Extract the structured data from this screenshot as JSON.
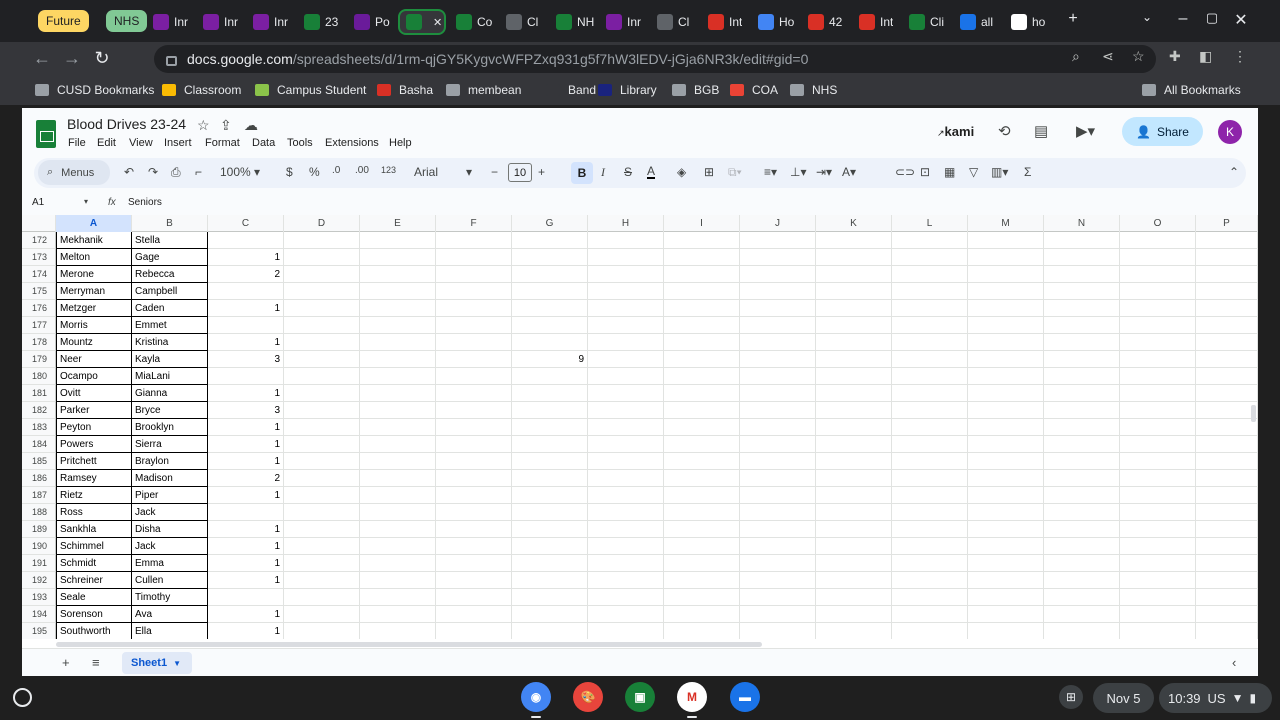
{
  "browser": {
    "group_labels": [
      {
        "label": "Future",
        "bg": "#fdd663",
        "fg": "#202124"
      },
      {
        "label": "NHS",
        "bg": "#81c995",
        "fg": "#202124"
      }
    ],
    "tabs": [
      {
        "title": "Inr",
        "icon": "membean-icon",
        "color": "#7b1fa2"
      },
      {
        "title": "Inr",
        "icon": "membean-icon",
        "color": "#7b1fa2"
      },
      {
        "title": "Inr",
        "icon": "membean-icon",
        "color": "#7b1fa2"
      },
      {
        "title": "23",
        "icon": "sheets-icon",
        "color": "#188038"
      },
      {
        "title": "Po",
        "icon": "vocab-icon",
        "color": "#6a1b9a"
      },
      {
        "title": "",
        "icon": "sheets-icon",
        "color": "#188038",
        "active": true
      },
      {
        "title": "Co",
        "icon": "sheets-icon",
        "color": "#188038"
      },
      {
        "title": "Cl",
        "icon": "classroom-icon",
        "color": "#5f6368"
      },
      {
        "title": "NH",
        "icon": "sheets-icon",
        "color": "#188038"
      },
      {
        "title": "Inr",
        "icon": "membean-icon",
        "color": "#7b1fa2"
      },
      {
        "title": "Cl",
        "icon": "classroom-icon",
        "color": "#5f6368"
      },
      {
        "title": "Int",
        "icon": "gmail-icon",
        "color": "#d93025"
      },
      {
        "title": "Ho",
        "icon": "media-icon",
        "color": "#4285f4"
      },
      {
        "title": "42",
        "icon": "basha-icon",
        "color": "#d93025"
      },
      {
        "title": "Int",
        "icon": "gmail-icon",
        "color": "#d93025"
      },
      {
        "title": "Cli",
        "icon": "sheets-icon",
        "color": "#188038"
      },
      {
        "title": "all",
        "icon": "helmet-icon",
        "color": "#1a73e8"
      },
      {
        "title": "ho",
        "icon": "google-icon",
        "color": "#ffffff"
      }
    ],
    "new_tab": "+",
    "url_host": "docs.google.com",
    "url_path": "/spreadsheets/d/1rm-qjGY5KygvcWFPZxq931g5f7hW3lEDV-jGja6NR3k/edit#gid=0",
    "bookmarks": [
      {
        "label": "CUSD Bookmarks",
        "icon": "folder-icon"
      },
      {
        "label": "Classroom",
        "icon": "classroom-icon",
        "color": "#fbbc04"
      },
      {
        "label": "Campus Student",
        "icon": "campus-icon",
        "color": "#8bc34a"
      },
      {
        "label": "Basha",
        "icon": "basha-icon",
        "color": "#d93025"
      },
      {
        "label": "membean",
        "icon": "membean-icon",
        "color": "#9aa0a6"
      },
      {
        "label": "Band",
        "icon": "band-icon",
        "color": "#35363a"
      },
      {
        "label": "Library",
        "icon": "library-icon",
        "color": "#1a237e"
      },
      {
        "label": "BGB",
        "icon": "folder-icon"
      },
      {
        "label": "COA",
        "icon": "coa-icon",
        "color": "#ea4335"
      },
      {
        "label": "NHS",
        "icon": "folder-icon"
      }
    ],
    "all_bookmarks": "All Bookmarks"
  },
  "sheets": {
    "doc_title": "Blood Drives 23-24",
    "menu": [
      "File",
      "Edit",
      "View",
      "Insert",
      "Format",
      "Data",
      "Tools",
      "Extensions",
      "Help"
    ],
    "kami_label": "kami",
    "share_label": "Share",
    "avatar_letter": "K",
    "toolbar": {
      "menus_label": "Menus",
      "zoom": "100%",
      "currency": "$",
      "percent": "%",
      "decrease_decimal": ".0",
      "increase_decimal": ".00",
      "number_format": "123",
      "font": "Arial",
      "font_size": "10",
      "bold": "B",
      "italic": "I",
      "text_color": "A"
    },
    "name_box": "A1",
    "formula_value": "Seniors",
    "columns": [
      "A",
      "B",
      "C",
      "D",
      "E",
      "F",
      "G",
      "H",
      "I",
      "J",
      "K",
      "L",
      "M",
      "N",
      "O",
      "P"
    ],
    "rows": [
      {
        "n": "172",
        "last": "Mekhanik",
        "first": "Stella",
        "c": ""
      },
      {
        "n": "173",
        "last": "Melton",
        "first": "Gage",
        "c": "1"
      },
      {
        "n": "174",
        "last": "Merone",
        "first": "Rebecca",
        "c": "2"
      },
      {
        "n": "175",
        "last": "Merryman",
        "first": "Campbell",
        "c": ""
      },
      {
        "n": "176",
        "last": "Metzger",
        "first": "Caden",
        "c": "1"
      },
      {
        "n": "177",
        "last": "Morris",
        "first": "Emmet",
        "c": ""
      },
      {
        "n": "178",
        "last": "Mountz",
        "first": "Kristina",
        "c": "1"
      },
      {
        "n": "179",
        "last": "Neer",
        "first": "Kayla",
        "c": "3",
        "g": "9"
      },
      {
        "n": "180",
        "last": "Ocampo",
        "first": "MiaLani",
        "c": ""
      },
      {
        "n": "181",
        "last": "Ovitt",
        "first": "Gianna",
        "c": "1"
      },
      {
        "n": "182",
        "last": "Parker",
        "first": "Bryce",
        "c": "3"
      },
      {
        "n": "183",
        "last": "Peyton",
        "first": "Brooklyn",
        "c": "1"
      },
      {
        "n": "184",
        "last": "Powers",
        "first": "Sierra",
        "c": "1"
      },
      {
        "n": "185",
        "last": "Pritchett",
        "first": "Braylon",
        "c": "1"
      },
      {
        "n": "186",
        "last": "Ramsey",
        "first": "Madison",
        "c": "2"
      },
      {
        "n": "187",
        "last": "Rietz",
        "first": "Piper",
        "c": "1"
      },
      {
        "n": "188",
        "last": "Ross",
        "first": "Jack",
        "c": ""
      },
      {
        "n": "189",
        "last": "Sankhla",
        "first": "Disha",
        "c": "1"
      },
      {
        "n": "190",
        "last": "Schimmel",
        "first": "Jack",
        "c": "1"
      },
      {
        "n": "191",
        "last": "Schmidt",
        "first": "Emma",
        "c": "1"
      },
      {
        "n": "192",
        "last": "Schreiner",
        "first": "Cullen",
        "c": "1"
      },
      {
        "n": "193",
        "last": "Seale",
        "first": "Timothy",
        "c": ""
      },
      {
        "n": "194",
        "last": "Sorenson",
        "first": "Ava",
        "c": "1"
      },
      {
        "n": "195",
        "last": "Southworth",
        "first": "Ella",
        "c": "1"
      }
    ],
    "sheet_tab": "Sheet1"
  },
  "shelf": {
    "apps": [
      {
        "name": "chrome-icon",
        "color": "#4285f4"
      },
      {
        "name": "canvas-icon",
        "color": "#e8453c"
      },
      {
        "name": "classroom-app-icon",
        "color": "#188038"
      },
      {
        "name": "gmail-app-icon",
        "color": "#ffffff"
      },
      {
        "name": "files-icon",
        "color": "#1a73e8"
      }
    ],
    "date": "Nov 5",
    "time": "10:39",
    "locale": "US"
  }
}
